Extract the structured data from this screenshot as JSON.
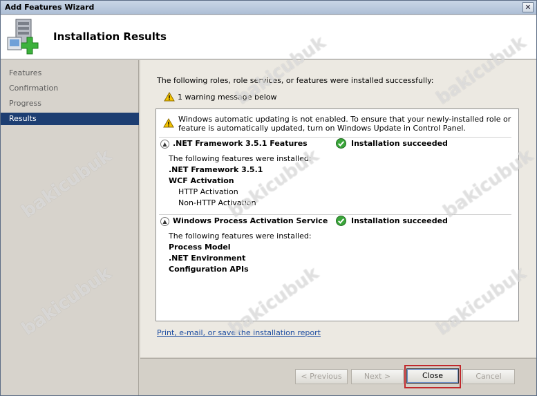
{
  "window": {
    "title": "Add Features Wizard",
    "close_glyph": "✕"
  },
  "header": {
    "title": "Installation Results"
  },
  "nav": {
    "items": [
      "Features",
      "Confirmation",
      "Progress",
      "Results"
    ],
    "active": "Results"
  },
  "main": {
    "intro": "The following roles, role services, or features were installed successfully:",
    "warning_count": "1 warning message below",
    "warning_text": "Windows automatic updating is not enabled. To ensure that your newly-installed role or feature is automatically updated, turn on Windows Update in Control Panel.",
    "sections": [
      {
        "name": ".NET Framework 3.5.1 Features",
        "status": "Installation succeeded",
        "intro": "The following features were installed:",
        "items": [
          {
            "label": ".NET Framework 3.5.1",
            "bold": true
          },
          {
            "label": "WCF Activation",
            "bold": true
          },
          {
            "label": "HTTP Activation",
            "bold": false
          },
          {
            "label": "Non-HTTP Activation",
            "bold": false
          }
        ]
      },
      {
        "name": "Windows Process Activation Service",
        "status": "Installation succeeded",
        "intro": "The following features were installed:",
        "items": [
          {
            "label": "Process Model",
            "bold": true
          },
          {
            "label": ".NET Environment",
            "bold": true
          },
          {
            "label": "Configuration APIs",
            "bold": true
          }
        ]
      }
    ],
    "report_link": "Print, e-mail, or save the installation report"
  },
  "buttons": {
    "previous": "< Previous",
    "next": "Next >",
    "close": "Close",
    "cancel": "Cancel"
  },
  "watermark": "bakicubuk",
  "colors": {
    "nav_active": "#1d3e72",
    "highlight": "#c0282c",
    "link": "#1c4ca0"
  }
}
